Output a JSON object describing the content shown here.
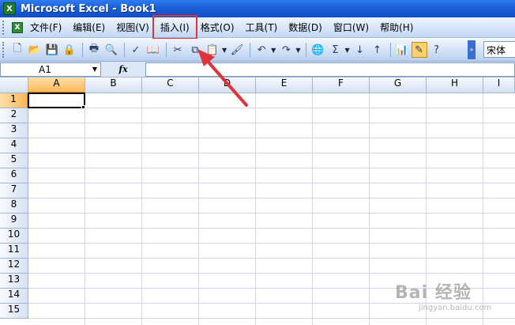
{
  "window": {
    "title": "Microsoft Excel - Book1",
    "icon": "excel-icon"
  },
  "menu": {
    "items": [
      {
        "label": "文件(F)"
      },
      {
        "label": "编辑(E)"
      },
      {
        "label": "视图(V)"
      },
      {
        "label": "插入(I)",
        "highlighted": true
      },
      {
        "label": "格式(O)"
      },
      {
        "label": "工具(T)"
      },
      {
        "label": "数据(D)"
      },
      {
        "label": "窗口(W)"
      },
      {
        "label": "帮助(H)"
      }
    ]
  },
  "toolbar": {
    "icons": [
      "new-icon",
      "open-icon",
      "save-icon",
      "permission-icon",
      "print-icon",
      "print-preview-icon",
      "spelling-icon",
      "research-icon",
      "cut-icon",
      "copy-icon",
      "paste-icon",
      "format-painter-icon",
      "undo-icon",
      "redo-icon",
      "hyperlink-icon",
      "autosum-icon",
      "sort-ascending-icon",
      "sort-descending-icon",
      "chart-wizard-icon",
      "drawing-icon",
      "help-icon"
    ],
    "font_name": "宋体"
  },
  "formula_bar": {
    "cell_ref": "A1",
    "fx_label": "fx",
    "content": ""
  },
  "grid": {
    "columns": [
      "A",
      "B",
      "C",
      "D",
      "E",
      "F",
      "G",
      "H",
      "I"
    ],
    "rows": [
      "1",
      "2",
      "3",
      "4",
      "5",
      "6",
      "7",
      "8",
      "9",
      "10",
      "11",
      "12",
      "13",
      "14",
      "15"
    ],
    "active_cell": "A1"
  },
  "annotation": {
    "arrow_color": "#e0323a",
    "target": "插入(I)"
  },
  "watermark": {
    "text": "Bai 经验",
    "sub": "jingyan.baidu.com"
  },
  "colors": {
    "title_bar": "#1c5fd6",
    "highlight_box": "#e0323a",
    "active_header": "#f9b85a"
  }
}
